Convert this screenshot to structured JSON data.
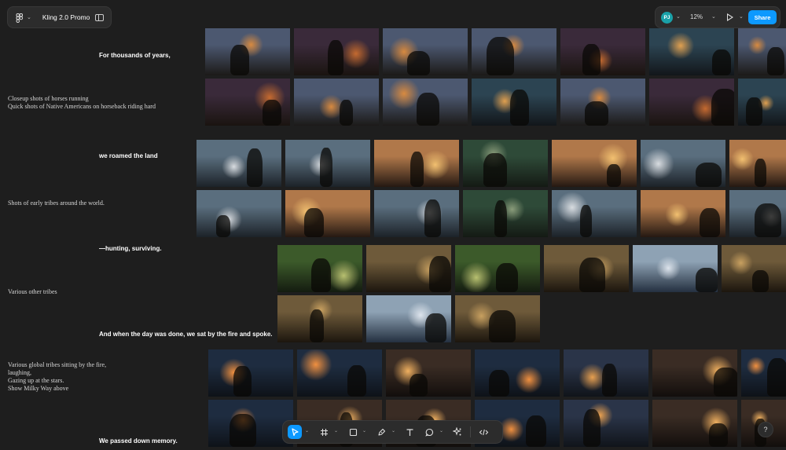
{
  "file": {
    "name": "Kling 2.0 Promo",
    "logo_icon": "figma-logo-icon",
    "panel_icon": "sidebar-toggle-icon"
  },
  "topbar": {
    "avatar_initials": "PJ",
    "zoom": "12%",
    "present_icon": "play-icon",
    "share_label": "Share",
    "accent_color": "#0d99ff"
  },
  "script": {
    "lines": [
      "For thousands of years,",
      "we roamed the land",
      "—hunting, surviving.",
      "And when the day was done, we sat by the fire and spoke.",
      "We passed down memory."
    ],
    "notes": [
      [
        "Closeup shots of horses running",
        "Quick shots of Native Americans on horseback riding hard"
      ],
      [
        "Shots of early tribes around the world."
      ],
      [
        "Various other tribes"
      ],
      [
        "Various global tribes sitting by the fire,",
        "laughing,",
        "Gazing up at the stars.",
        "Show Milky Way above"
      ]
    ]
  },
  "thumbnail_groups": [
    {
      "scene": "night horse riders with torches",
      "count": 14
    },
    {
      "scene": "early tribes around the world",
      "count": 14
    },
    {
      "scene": "hunting tribes in snow and jungle",
      "count": 9
    },
    {
      "scene": "tribes sitting by the fire",
      "count": 16
    }
  ],
  "toolbar": {
    "tools": [
      "move-icon",
      "frame-icon",
      "shape-rectangle-icon",
      "pen-icon",
      "text-icon",
      "comment-icon",
      "actions-icon",
      "dev-mode-icon"
    ]
  },
  "help_label": "?"
}
